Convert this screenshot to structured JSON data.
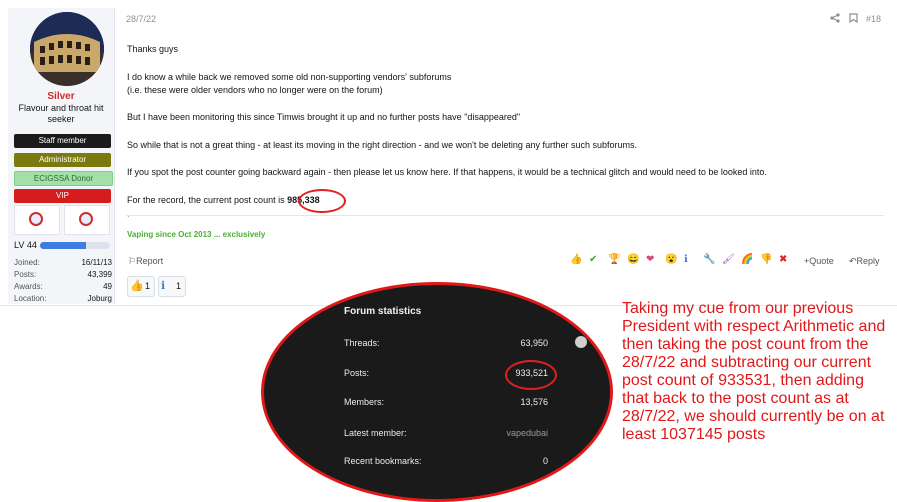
{
  "user": {
    "name": "Silver",
    "title": "Flavour and throat hit seeker",
    "banners": [
      "Staff member",
      "Administrator",
      "ECIGSSA Donor",
      "VIP"
    ],
    "level_label": "LV 44",
    "level_progress": 0.65,
    "stats": [
      {
        "label": "Joined:",
        "value": "16/11/13"
      },
      {
        "label": "Posts:",
        "value": "43,399"
      },
      {
        "label": "Awards:",
        "value": "49"
      },
      {
        "label": "Location:",
        "value": "Joburg"
      }
    ]
  },
  "post": {
    "date": "28/7/22",
    "number": "#18",
    "icons": [
      "share-icon",
      "bookmark-icon"
    ],
    "lines": [
      "Thanks guys",
      "I do know a while back we removed some old non-supporting vendors' subforums",
      "(i.e. these were older vendors who no longer were on the forum)",
      "But I have been monitoring this since Timwis brought it up and no further posts have \"disappeared\"",
      "So while that is not a great thing - at least its moving in the right direction - and we won't be deleting any further such subforums.",
      "If you spot the post counter going backward again - then please let us know here. If that happens, it would be a technical glitch and would need to be looked into."
    ],
    "record_prefix": "For the record, the current post count is ",
    "record_count": "985,338",
    "dot": ".",
    "signature": "Vaping since Oct 2013 ... exclusively",
    "report_label": "Report",
    "quote_label": "+Quote",
    "reply_label": "Reply",
    "reaction_icons": [
      "👍",
      "✔",
      "🏆",
      "😄",
      "❤",
      "😮",
      "ℹ",
      "🔧",
      "🖌",
      "🌈",
      "👎",
      "✖"
    ],
    "reactions": [
      {
        "icon": "👍",
        "count": "1"
      },
      {
        "icon": "ℹ",
        "count": "1"
      }
    ]
  },
  "forum_stats": {
    "title": "Forum statistics",
    "rows": [
      {
        "label": "Threads:",
        "value": "63,950"
      },
      {
        "label": "Posts:",
        "value": "933,521"
      },
      {
        "label": "Members:",
        "value": "13,576"
      },
      {
        "label": "Latest member:",
        "value": "vapedubai"
      },
      {
        "label": "Recent bookmarks:",
        "value": "0"
      }
    ]
  },
  "annotation": "Taking my cue from our previous President with respect Arithmetic and then taking the post count from the 28/7/22 and subtracting our current post count of 933531, then adding that back to the post count as at 28/7/22, we should currently be on at least 1037145 posts",
  "colors": {
    "accent": "#3d7de0",
    "username": "#cf2a2a",
    "annotation": "#e01818",
    "signature": "#4cae32"
  }
}
